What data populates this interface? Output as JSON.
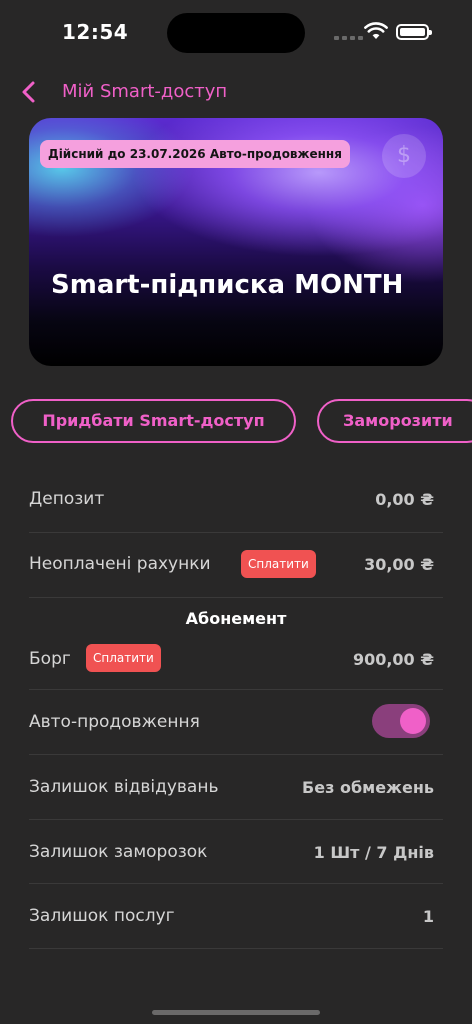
{
  "status_bar": {
    "time": "12:54"
  },
  "header": {
    "title": "Мій Smart-доступ"
  },
  "card": {
    "badge": "Дійсний до 23.07.2026 Авто-продовження",
    "coin_symbol": "$",
    "title": "Smart-підписка MONTH"
  },
  "actions": {
    "buy_label": "Придбати Smart-доступ",
    "freeze_label": "Заморозити"
  },
  "rows": {
    "deposit": {
      "label": "Депозит",
      "value": "0,00 ₴"
    },
    "unpaid": {
      "label": "Неоплачені рахунки",
      "pay_label": "Сплатити",
      "value": "30,00 ₴"
    }
  },
  "subscription": {
    "section_title": "Абонемент",
    "debt": {
      "label": "Борг",
      "pay_label": "Сплатити",
      "value": "900,00 ₴"
    },
    "auto_renewal": {
      "label": "Авто-продовження",
      "enabled": true
    },
    "visits_left": {
      "label": "Залишок відвідувань",
      "value": "Без обмежень"
    },
    "freezes_left": {
      "label": "Залишок заморозок",
      "value": "1 Шт / 7 Днів"
    },
    "services_left": {
      "label": "Залишок послуг",
      "value": "1"
    }
  },
  "colors": {
    "accent": "#f060c8",
    "background": "#282727",
    "danger": "#f05252",
    "toggle_track": "#8a3f7c"
  }
}
